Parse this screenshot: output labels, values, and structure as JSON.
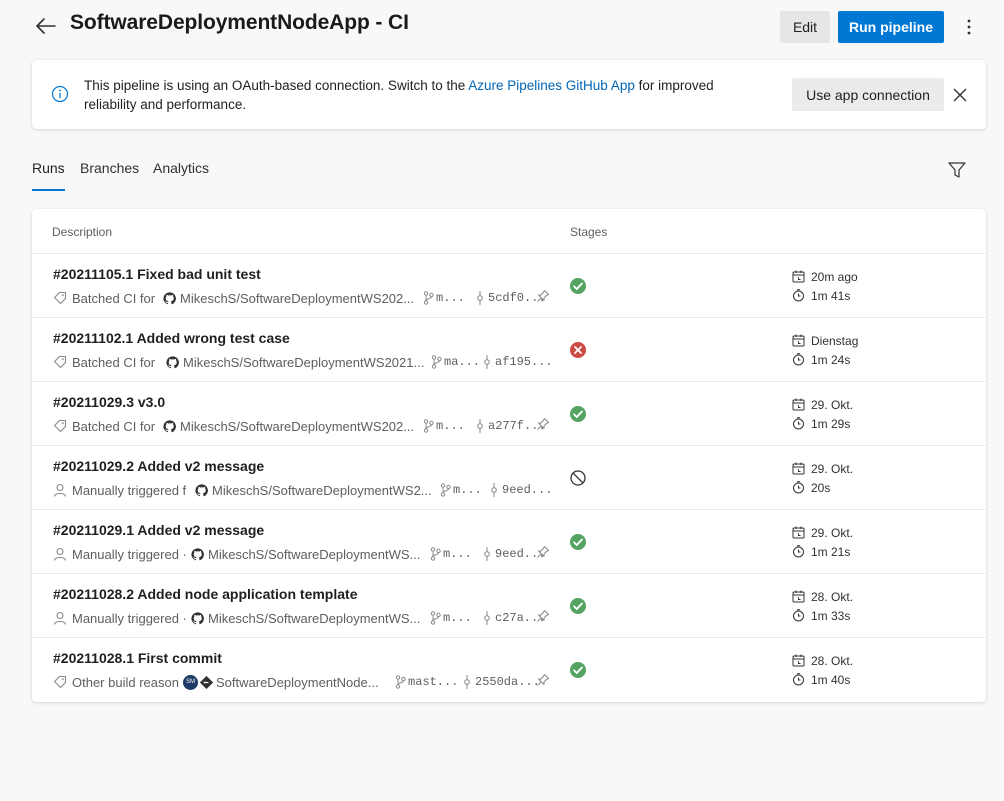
{
  "header": {
    "title": "SoftwareDeploymentNodeApp - CI",
    "edit_label": "Edit",
    "run_label": "Run pipeline"
  },
  "banner": {
    "text_before": "This pipeline is using an OAuth-based connection. Switch to the ",
    "link_text": "Azure Pipelines GitHub App",
    "text_after": " for improved reliability and performance.",
    "button_label": "Use app connection"
  },
  "tabs": [
    {
      "label": "Runs",
      "active": true
    },
    {
      "label": "Branches",
      "active": false
    },
    {
      "label": "Analytics",
      "active": false
    }
  ],
  "table": {
    "col_description": "Description",
    "col_stages": "Stages"
  },
  "colors": {
    "accent": "#0078d4",
    "success": "#55a362",
    "failed": "#cd4a45",
    "canceled": "#323130"
  },
  "runs": [
    {
      "title": "#20211105.1 Fixed bad unit test",
      "trigger_icon": "tag-icon",
      "reason": "Batched CI for",
      "repo_icon": "github-icon",
      "repo": "MikeschS/SoftwareDeploymentWS202...",
      "branch": "m...",
      "commit": "5cdf0...",
      "pinned_icon": true,
      "status": "succeeded",
      "date": "20m ago",
      "duration": "1m 41s"
    },
    {
      "title": "#20211102.1 Added wrong test case",
      "trigger_icon": "tag-icon",
      "reason": "Batched CI for",
      "repo_icon": "github-icon",
      "repo": "MikeschS/SoftwareDeploymentWS2021...",
      "branch": "ma...",
      "commit": "af195...",
      "pinned_icon": false,
      "status": "failed",
      "date": "Dienstag",
      "duration": "1m 24s"
    },
    {
      "title": "#20211029.3 v3.0",
      "trigger_icon": "tag-icon",
      "reason": "Batched CI for",
      "repo_icon": "github-icon",
      "repo": "MikeschS/SoftwareDeploymentWS202...",
      "branch": "m...",
      "commit": "a277f...",
      "pinned_icon": true,
      "status": "succeeded",
      "date": "29. Okt.",
      "duration": "1m 29s"
    },
    {
      "title": "#20211029.2 Added v2 message",
      "trigger_icon": "person-icon",
      "reason": "Manually triggered f",
      "repo_icon": "github-icon",
      "repo": "MikeschS/SoftwareDeploymentWS2...",
      "branch": "m...",
      "commit": "9eed...",
      "pinned_icon": false,
      "status": "canceled",
      "date": "29. Okt.",
      "duration": "20s"
    },
    {
      "title": "#20211029.1 Added v2 message",
      "trigger_icon": "person-icon",
      "reason": "Manually triggered ·",
      "repo_icon": "github-icon",
      "repo": "MikeschS/SoftwareDeploymentWS...",
      "branch": "m...",
      "commit": "9eed...",
      "pinned_icon": true,
      "status": "succeeded",
      "date": "29. Okt.",
      "duration": "1m 21s"
    },
    {
      "title": "#20211028.2 Added node application template",
      "trigger_icon": "person-icon",
      "reason": "Manually triggered ·",
      "repo_icon": "github-icon",
      "repo": "MikeschS/SoftwareDeploymentWS...",
      "branch": "m...",
      "commit": "c27a...",
      "pinned_icon": true,
      "status": "succeeded",
      "date": "28. Okt.",
      "duration": "1m 33s"
    },
    {
      "title": "#20211028.1 First commit",
      "trigger_icon": "tag-icon",
      "reason": "Other build reason",
      "avatar_initials": "SM",
      "repo_icon": "git-icon",
      "repo": "SoftwareDeploymentNode...",
      "branch": "mast...",
      "commit": "2550da...",
      "pinned_icon": true,
      "status": "succeeded",
      "date": "28. Okt.",
      "duration": "1m 40s"
    }
  ]
}
